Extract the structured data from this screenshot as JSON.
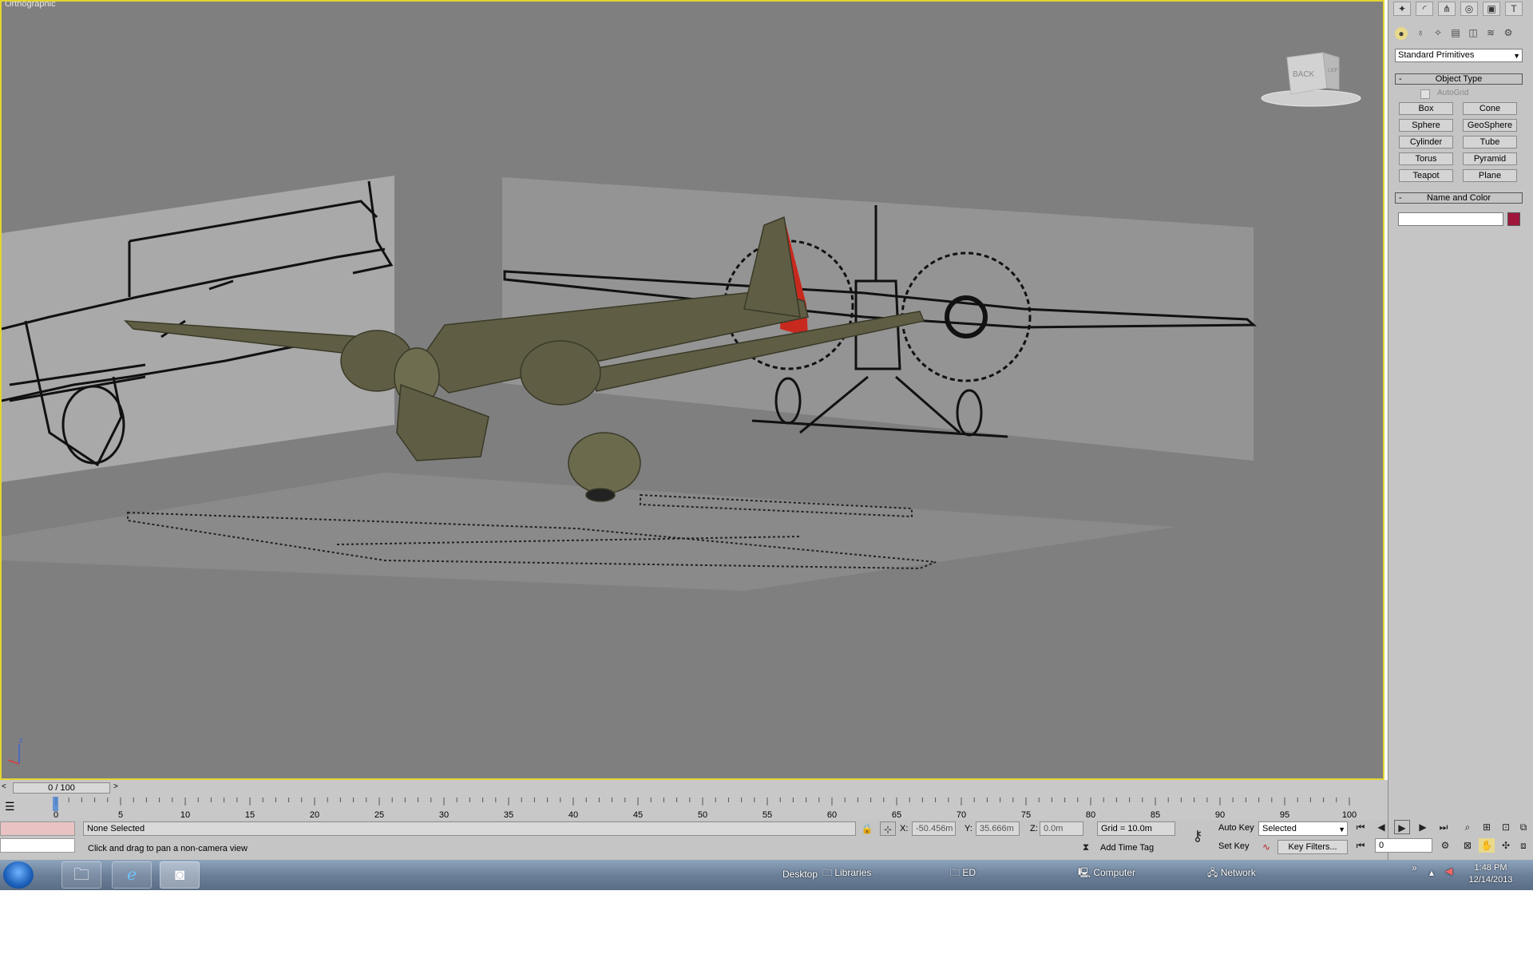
{
  "viewport": {
    "label": "Orthographic",
    "viewcube_back": "BACK",
    "viewcube_left": "LEFT"
  },
  "command_panel": {
    "primitive_set": "Standard Primitives",
    "object_type": {
      "title": "Object Type",
      "autogrid": "AutoGrid",
      "buttons": [
        "Box",
        "Cone",
        "Sphere",
        "GeoSphere",
        "Cylinder",
        "Tube",
        "Torus",
        "Pyramid",
        "Teapot",
        "Plane"
      ]
    },
    "name_and_color": {
      "title": "Name and Color",
      "name_value": "",
      "color": "#a0173c"
    }
  },
  "timeline": {
    "slider": "0 / 100",
    "ticks": [
      "0",
      "5",
      "10",
      "15",
      "20",
      "25",
      "30",
      "35",
      "40",
      "45",
      "50",
      "55",
      "60",
      "65",
      "70",
      "75",
      "80",
      "85",
      "90",
      "95",
      "100"
    ]
  },
  "status": {
    "selection": "None Selected",
    "prompt": "Click and drag to pan a non-camera view",
    "x_label": "X:",
    "x_value": "-50.456m",
    "y_label": "Y:",
    "y_value": "35.666m",
    "z_label": "Z:",
    "z_value": "0.0m",
    "grid": "Grid = 10.0m",
    "add_time_tag": "Add Time Tag",
    "auto_key": "Auto Key",
    "set_key": "Set Key",
    "key_mode": "Selected",
    "key_filters": "Key Filters...",
    "frame": "0"
  },
  "taskbar": {
    "links": [
      "Desktop",
      "Libraries",
      "ED",
      "Computer",
      "Network"
    ],
    "time": "1:48 PM",
    "date": "12/14/2013"
  }
}
